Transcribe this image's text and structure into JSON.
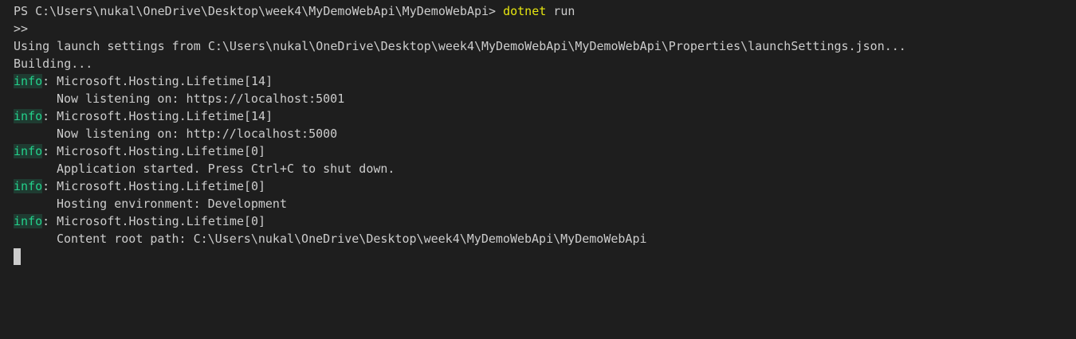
{
  "terminal": {
    "prompt": "PS C:\\Users\\nukal\\OneDrive\\Desktop\\week4\\MyDemoWebApi\\MyDemoWebApi> ",
    "command": "dotnet",
    "command_args": " run",
    "continuation": ">>",
    "launch_line": "Using launch settings from C:\\Users\\nukal\\OneDrive\\Desktop\\week4\\MyDemoWebApi\\MyDemoWebApi\\Properties\\launchSettings.json...",
    "building_line": "Building...",
    "log_entries": [
      {
        "level": "info",
        "source": ": Microsoft.Hosting.Lifetime[14]",
        "message": "Now listening on: https://localhost:5001"
      },
      {
        "level": "info",
        "source": ": Microsoft.Hosting.Lifetime[14]",
        "message": "Now listening on: http://localhost:5000"
      },
      {
        "level": "info",
        "source": ": Microsoft.Hosting.Lifetime[0]",
        "message": "Application started. Press Ctrl+C to shut down."
      },
      {
        "level": "info",
        "source": ": Microsoft.Hosting.Lifetime[0]",
        "message": "Hosting environment: Development"
      },
      {
        "level": "info",
        "source": ": Microsoft.Hosting.Lifetime[0]",
        "message": "Content root path: C:\\Users\\nukal\\OneDrive\\Desktop\\week4\\MyDemoWebApi\\MyDemoWebApi"
      }
    ]
  },
  "colors": {
    "background": "#1e1e1e",
    "foreground": "#cccccc",
    "info": "#23d18b",
    "command": "#e5e510"
  }
}
